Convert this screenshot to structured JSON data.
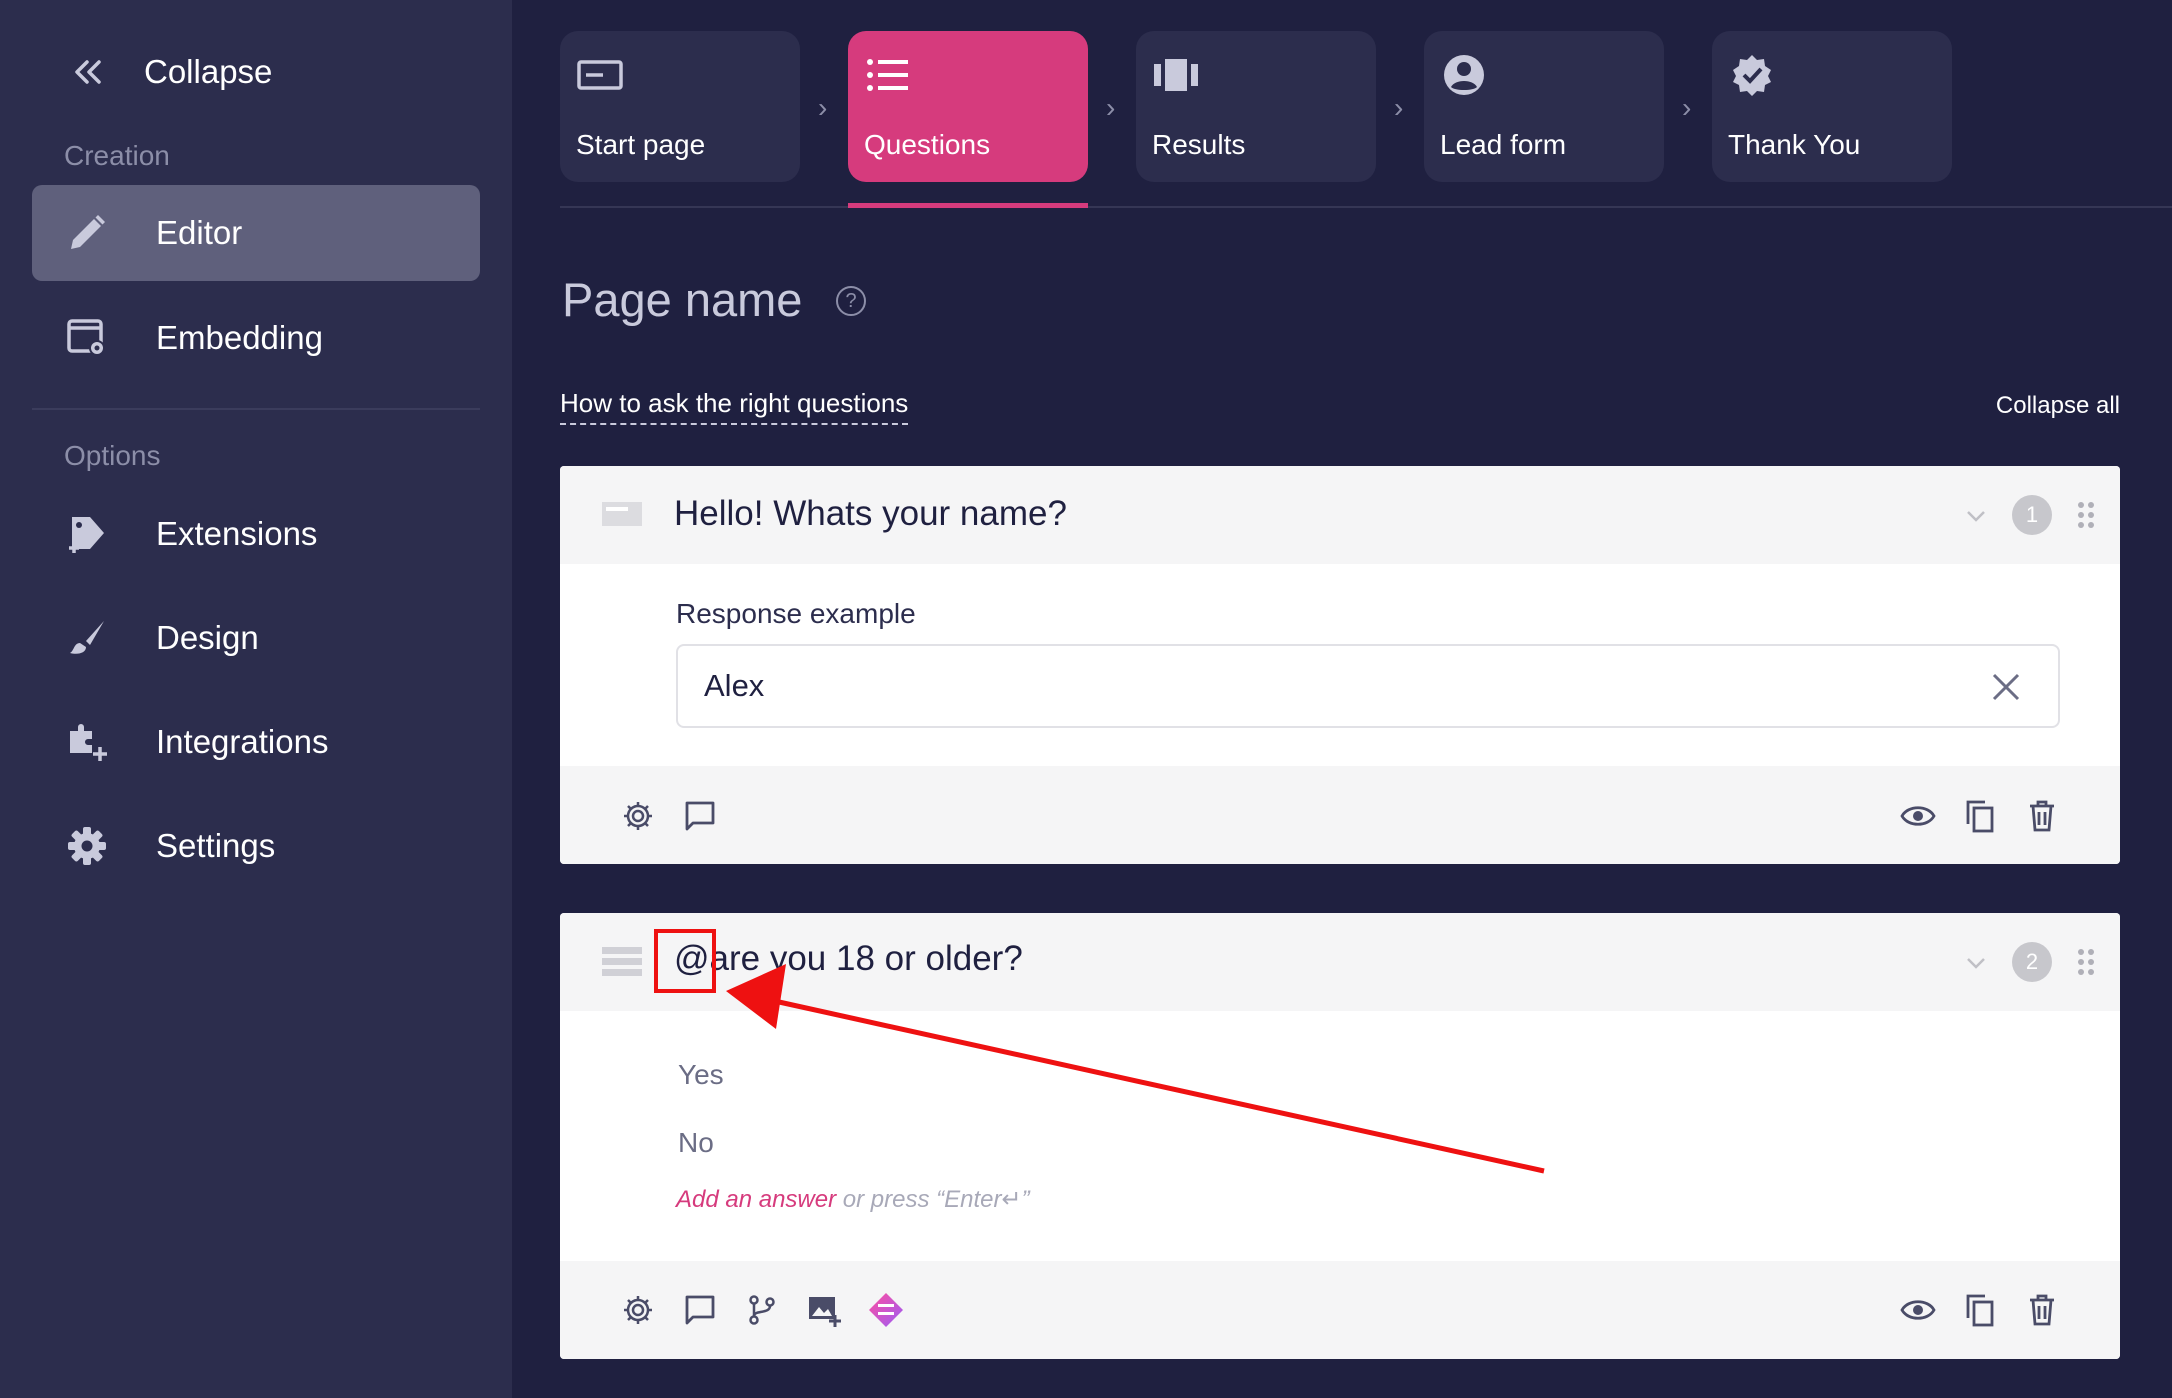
{
  "sidebar": {
    "collapse_label": "Collapse",
    "creation_label": "Creation",
    "options_label": "Options",
    "items": [
      {
        "label": "Editor",
        "icon": "pencil-icon",
        "active": true
      },
      {
        "label": "Embedding",
        "icon": "embed-settings-icon"
      },
      {
        "label": "Extensions",
        "icon": "extension-tag-icon"
      },
      {
        "label": "Design",
        "icon": "brush-icon"
      },
      {
        "label": "Integrations",
        "icon": "integration-plus-icon"
      },
      {
        "label": "Settings",
        "icon": "gear-icon"
      }
    ]
  },
  "steps": [
    {
      "label": "Start page",
      "icon": "start-page-icon"
    },
    {
      "label": "Questions",
      "icon": "list-icon",
      "active": true
    },
    {
      "label": "Results",
      "icon": "results-icon"
    },
    {
      "label": "Lead form",
      "icon": "account-circle-icon"
    },
    {
      "label": "Thank You",
      "icon": "verified-badge-icon"
    }
  ],
  "page": {
    "title": "Page name",
    "help_glyph": "?",
    "guide_link": "How to ask the right questions",
    "collapse_all": "Collapse all"
  },
  "questions": [
    {
      "number": "1",
      "title": "Hello! Whats your name?",
      "type_icon": "text-input-icon",
      "response_label": "Response example",
      "response_value": "Alex"
    },
    {
      "number": "2",
      "title_prefix": "@",
      "title": "are you 18 or older?",
      "type_icon": "choice-list-icon",
      "answers": [
        "Yes",
        "No"
      ],
      "add_answer_link": "Add an answer",
      "add_answer_hint": " or press “Enter↵”"
    }
  ],
  "colors": {
    "background": "#1f2040",
    "sidebar": "#2c2d4d",
    "accent": "#d63b7d",
    "annotation": "#ee1111"
  }
}
